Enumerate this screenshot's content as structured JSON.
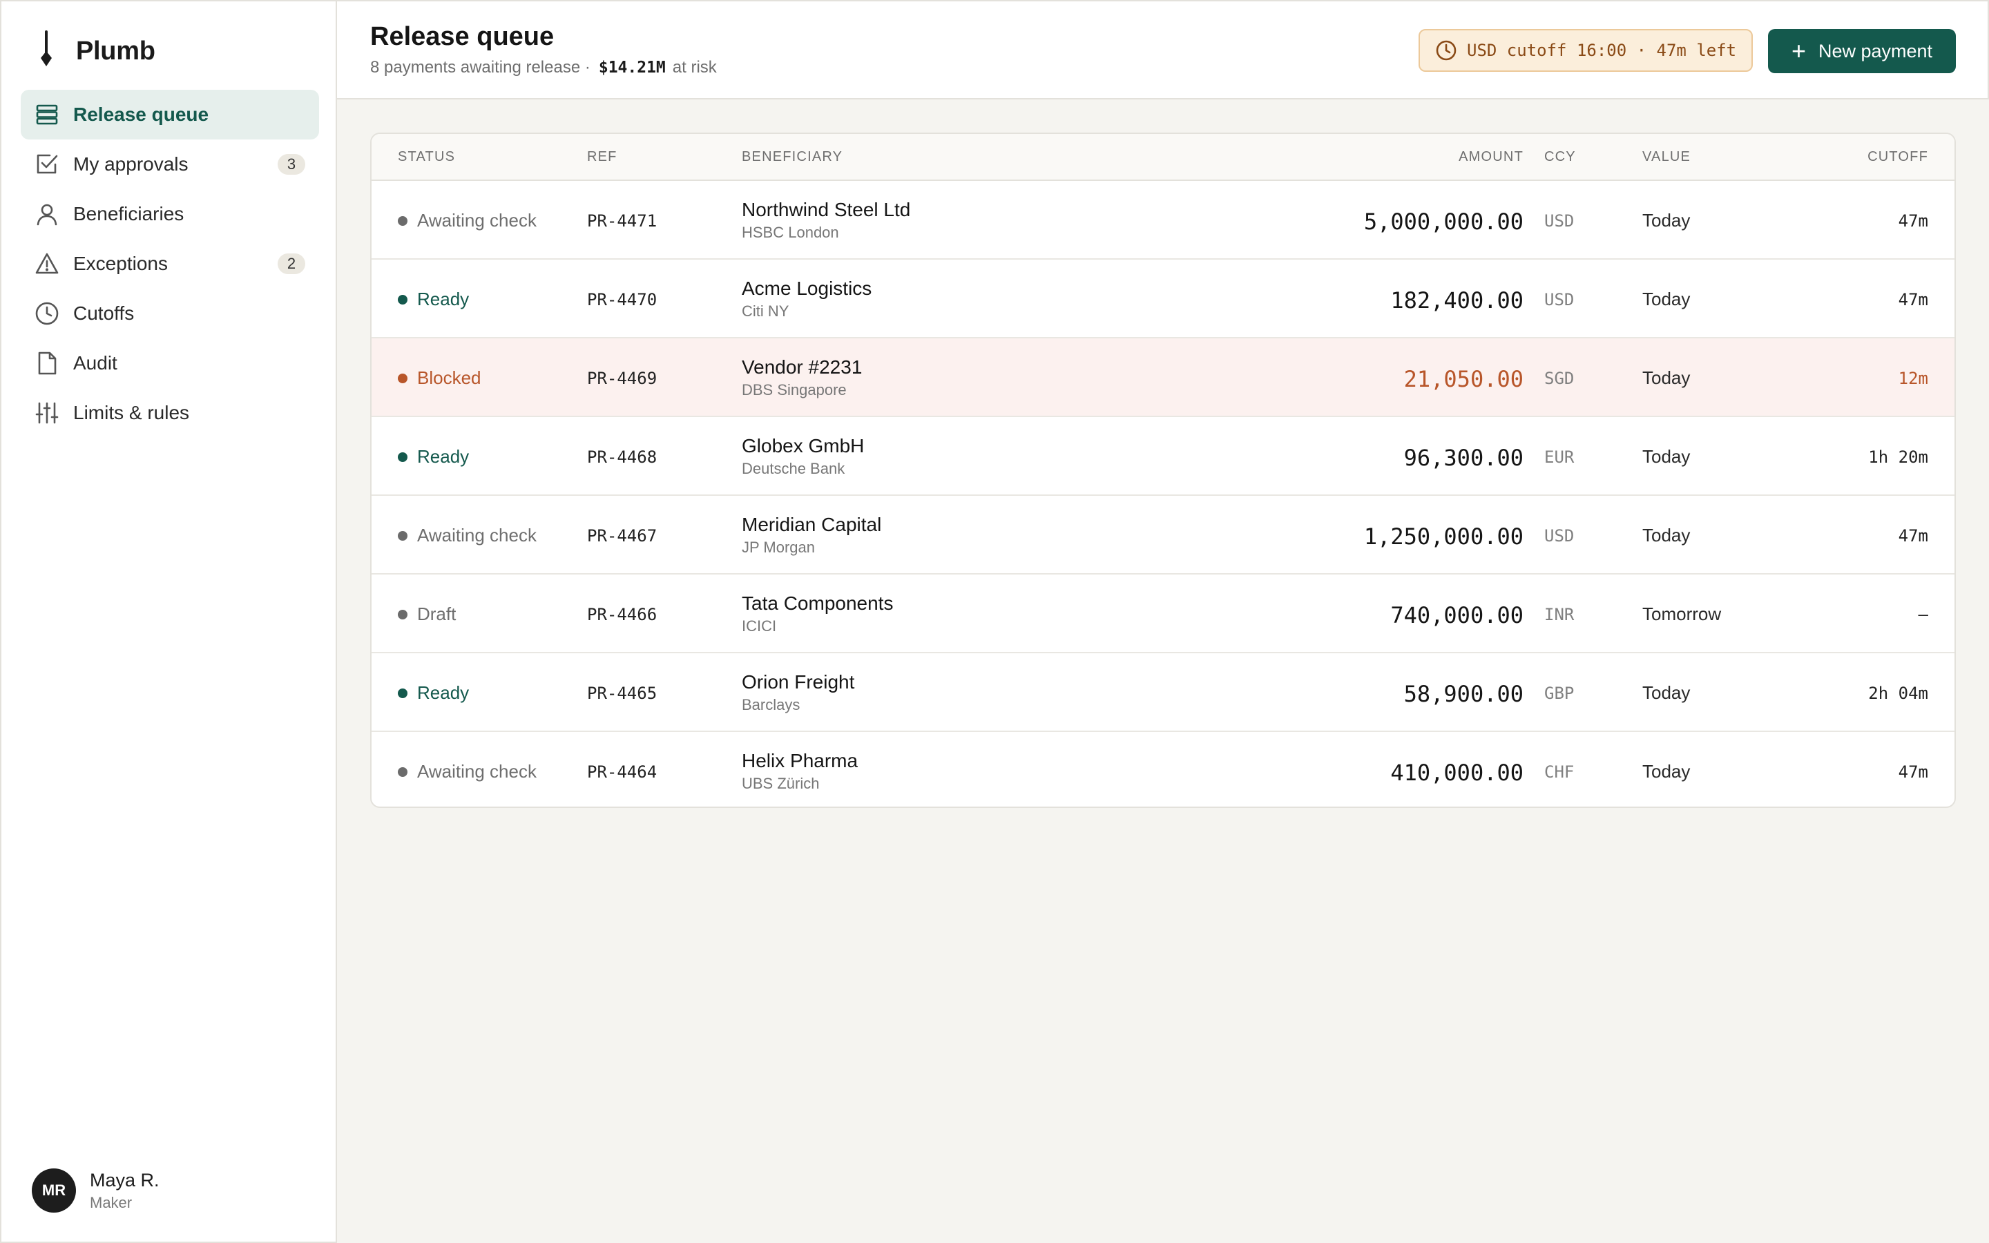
{
  "brand": {
    "name": "Plumb"
  },
  "sidebar": {
    "items": [
      {
        "label": "Release queue",
        "icon": "stack-icon",
        "active": true,
        "badge": ""
      },
      {
        "label": "My approvals",
        "icon": "check-square-icon",
        "active": false,
        "badge": "3"
      },
      {
        "label": "Beneficiaries",
        "icon": "person-icon",
        "active": false,
        "badge": ""
      },
      {
        "label": "Exceptions",
        "icon": "warning-triangle-icon",
        "active": false,
        "badge": "2"
      },
      {
        "label": "Cutoffs",
        "icon": "clock-icon",
        "active": false,
        "badge": ""
      },
      {
        "label": "Audit",
        "icon": "document-icon",
        "active": false,
        "badge": ""
      },
      {
        "label": "Limits & rules",
        "icon": "sliders-icon",
        "active": false,
        "badge": ""
      }
    ]
  },
  "user": {
    "initials": "MR",
    "name": "Maya R.",
    "role": "Maker"
  },
  "header": {
    "title": "Release queue",
    "subtitle_prefix": "8 payments awaiting release ·",
    "risk_value": "$14.21M",
    "subtitle_suffix": "at risk",
    "cutoff_pill": "USD cutoff 16:00 · 47m left",
    "new_button": "New payment"
  },
  "colors": {
    "accent": "#14594d",
    "ready": "#14594d",
    "blocked": "#b8562a",
    "neutral": "#6b6b6b",
    "blocked_row_bg": "#fcf1ef",
    "warning_pill_bg": "#fbeedb"
  },
  "table": {
    "headers": {
      "status": "STATUS",
      "ref": "REF",
      "beneficiary": "BENEFICIARY",
      "amount": "AMOUNT",
      "ccy": "CCY",
      "value": "VALUE",
      "cutoff": "CUTOFF"
    },
    "rows": [
      {
        "status": "Awaiting check",
        "kind": "neutral",
        "ref": "PR-4471",
        "name": "Northwind Steel Ltd",
        "bank": "HSBC London",
        "amount": "5,000,000.00",
        "ccy": "USD",
        "value": "Today",
        "cutoff": "47m"
      },
      {
        "status": "Ready",
        "kind": "ready",
        "ref": "PR-4470",
        "name": "Acme Logistics",
        "bank": "Citi NY",
        "amount": "182,400.00",
        "ccy": "USD",
        "value": "Today",
        "cutoff": "47m"
      },
      {
        "status": "Blocked",
        "kind": "blocked",
        "ref": "PR-4469",
        "name": "Vendor #2231",
        "bank": "DBS Singapore",
        "amount": "21,050.00",
        "ccy": "SGD",
        "value": "Today",
        "cutoff": "12m"
      },
      {
        "status": "Ready",
        "kind": "ready",
        "ref": "PR-4468",
        "name": "Globex GmbH",
        "bank": "Deutsche Bank",
        "amount": "96,300.00",
        "ccy": "EUR",
        "value": "Today",
        "cutoff": "1h 20m"
      },
      {
        "status": "Awaiting check",
        "kind": "neutral",
        "ref": "PR-4467",
        "name": "Meridian Capital",
        "bank": "JP Morgan",
        "amount": "1,250,000.00",
        "ccy": "USD",
        "value": "Today",
        "cutoff": "47m"
      },
      {
        "status": "Draft",
        "kind": "neutral",
        "ref": "PR-4466",
        "name": "Tata Components",
        "bank": "ICICI",
        "amount": "740,000.00",
        "ccy": "INR",
        "value": "Tomorrow",
        "cutoff": "—"
      },
      {
        "status": "Ready",
        "kind": "ready",
        "ref": "PR-4465",
        "name": "Orion Freight",
        "bank": "Barclays",
        "amount": "58,900.00",
        "ccy": "GBP",
        "value": "Today",
        "cutoff": "2h 04m"
      },
      {
        "status": "Awaiting check",
        "kind": "neutral",
        "ref": "PR-4464",
        "name": "Helix Pharma",
        "bank": "UBS Zürich",
        "amount": "410,000.00",
        "ccy": "CHF",
        "value": "Today",
        "cutoff": "47m"
      }
    ]
  }
}
